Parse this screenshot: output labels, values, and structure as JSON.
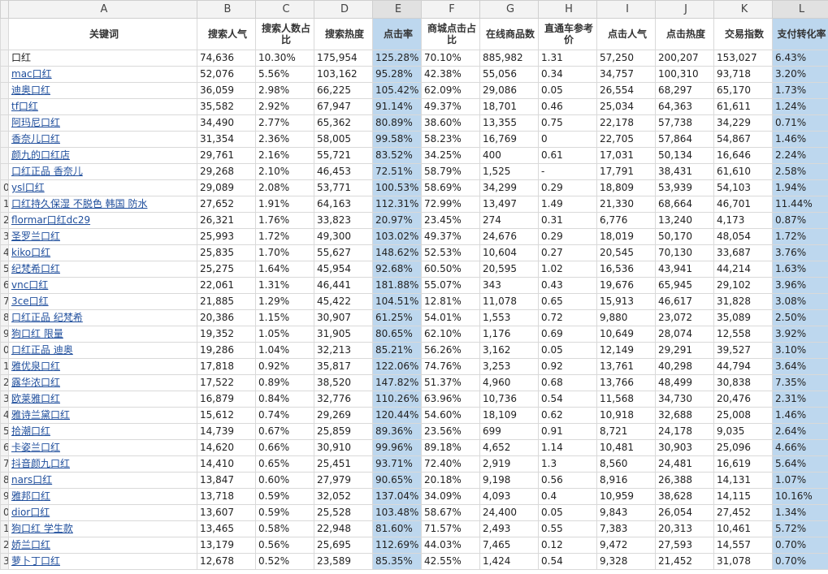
{
  "columns": [
    "A",
    "B",
    "C",
    "D",
    "E",
    "F",
    "G",
    "H",
    "I",
    "J",
    "K",
    "L"
  ],
  "headers": [
    "关键词",
    "搜索人气",
    "搜索人数占比",
    "搜索热度",
    "点击率",
    "商城点击占比",
    "在线商品数",
    "直通车参考价",
    "点击人气",
    "点击热度",
    "交易指数",
    "支付转化率"
  ],
  "rows": [
    {
      "n": "",
      "c": [
        "口红",
        "74,636",
        "10.30%",
        "175,954",
        "125.28%",
        "70.10%",
        "885,982",
        "1.31",
        "57,250",
        "200,207",
        "153,027",
        "6.43%"
      ]
    },
    {
      "n": "",
      "c": [
        "mac口红",
        "52,076",
        "5.56%",
        "103,162",
        "95.28%",
        "42.38%",
        "55,056",
        "0.34",
        "34,757",
        "100,310",
        "93,718",
        "3.20%"
      ]
    },
    {
      "n": "",
      "c": [
        "迪奥口红",
        "36,059",
        "2.98%",
        "66,225",
        "105.42%",
        "62.09%",
        "29,086",
        "0.05",
        "26,554",
        "68,297",
        "65,170",
        "1.73%"
      ]
    },
    {
      "n": "",
      "c": [
        "tf口红",
        "35,582",
        "2.92%",
        "67,947",
        "91.14%",
        "49.37%",
        "18,701",
        "0.46",
        "25,034",
        "64,363",
        "61,611",
        "1.24%"
      ]
    },
    {
      "n": "",
      "c": [
        "阿玛尼口红",
        "34,490",
        "2.77%",
        "65,362",
        "80.89%",
        "38.60%",
        "13,355",
        "0.75",
        "22,178",
        "57,738",
        "34,229",
        "0.71%"
      ]
    },
    {
      "n": "",
      "c": [
        "香奈儿口红",
        "31,354",
        "2.36%",
        "58,005",
        "99.58%",
        "58.23%",
        "16,769",
        "0",
        "22,705",
        "57,864",
        "54,867",
        "1.46%"
      ]
    },
    {
      "n": "",
      "c": [
        "颜九的口红店",
        "29,761",
        "2.16%",
        "55,721",
        "83.52%",
        "34.25%",
        "400",
        "0.61",
        "17,031",
        "50,134",
        "16,646",
        "2.24%"
      ]
    },
    {
      "n": "",
      "c": [
        "口红正品 香奈儿",
        "29,268",
        "2.10%",
        "46,453",
        "72.51%",
        "58.79%",
        "1,525",
        "-",
        "17,791",
        "38,431",
        "61,610",
        "2.58%"
      ]
    },
    {
      "n": "0",
      "c": [
        "ysl口红",
        "29,089",
        "2.08%",
        "53,771",
        "100.53%",
        "58.69%",
        "34,299",
        "0.29",
        "18,809",
        "53,939",
        "54,103",
        "1.94%"
      ]
    },
    {
      "n": "1",
      "c": [
        "口红持久保湿 不脱色 韩国 防水",
        "27,652",
        "1.91%",
        "64,163",
        "112.31%",
        "72.99%",
        "13,497",
        "1.49",
        "21,330",
        "68,664",
        "46,701",
        "11.44%"
      ]
    },
    {
      "n": "2",
      "c": [
        "flormar口红dc29",
        "26,321",
        "1.76%",
        "33,823",
        "20.97%",
        "23.45%",
        "274",
        "0.31",
        "6,776",
        "13,240",
        "4,173",
        "0.87%"
      ]
    },
    {
      "n": "3",
      "c": [
        "圣罗兰口红",
        "25,993",
        "1.72%",
        "49,300",
        "103.02%",
        "49.37%",
        "24,676",
        "0.29",
        "18,019",
        "50,170",
        "48,054",
        "1.72%"
      ]
    },
    {
      "n": "4",
      "c": [
        "kiko口红",
        "25,835",
        "1.70%",
        "55,627",
        "148.62%",
        "52.53%",
        "10,604",
        "0.27",
        "20,545",
        "70,130",
        "33,687",
        "3.76%"
      ]
    },
    {
      "n": "5",
      "c": [
        "纪梵希口红",
        "25,275",
        "1.64%",
        "45,954",
        "92.68%",
        "60.50%",
        "20,595",
        "1.02",
        "16,536",
        "43,941",
        "44,214",
        "1.63%"
      ]
    },
    {
      "n": "6",
      "c": [
        "vnc口红",
        "22,061",
        "1.31%",
        "46,441",
        "181.88%",
        "55.07%",
        "343",
        "0.43",
        "19,676",
        "65,945",
        "29,102",
        "3.96%"
      ]
    },
    {
      "n": "7",
      "c": [
        "3ce口红",
        "21,885",
        "1.29%",
        "45,422",
        "104.51%",
        "12.81%",
        "11,078",
        "0.65",
        "15,913",
        "46,617",
        "31,828",
        "3.08%"
      ]
    },
    {
      "n": "8",
      "c": [
        "口红正品 纪梵希",
        "20,386",
        "1.15%",
        "30,907",
        "61.25%",
        "54.01%",
        "1,553",
        "0.72",
        "9,880",
        "23,072",
        "35,089",
        "2.50%"
      ]
    },
    {
      "n": "9",
      "c": [
        "狗口红 限量",
        "19,352",
        "1.05%",
        "31,905",
        "80.65%",
        "62.10%",
        "1,176",
        "0.69",
        "10,649",
        "28,074",
        "12,558",
        "3.92%"
      ]
    },
    {
      "n": "0",
      "c": [
        "口红正品 迪奥",
        "19,286",
        "1.04%",
        "32,213",
        "85.21%",
        "56.26%",
        "3,162",
        "0.05",
        "12,149",
        "29,291",
        "39,527",
        "3.10%"
      ]
    },
    {
      "n": "1",
      "c": [
        "雅优泉口红",
        "17,818",
        "0.92%",
        "35,817",
        "122.06%",
        "74.76%",
        "3,253",
        "0.92",
        "13,761",
        "40,298",
        "44,794",
        "3.64%"
      ]
    },
    {
      "n": "2",
      "c": [
        "露华浓口红",
        "17,522",
        "0.89%",
        "38,520",
        "147.82%",
        "51.37%",
        "4,960",
        "0.68",
        "13,766",
        "48,499",
        "30,838",
        "7.35%"
      ]
    },
    {
      "n": "3",
      "c": [
        "欧莱雅口红",
        "16,879",
        "0.84%",
        "32,776",
        "110.26%",
        "63.96%",
        "10,736",
        "0.54",
        "11,568",
        "34,730",
        "20,476",
        "2.31%"
      ]
    },
    {
      "n": "4",
      "c": [
        "雅诗兰黛口红",
        "15,612",
        "0.74%",
        "29,269",
        "120.44%",
        "54.60%",
        "18,109",
        "0.62",
        "10,918",
        "32,688",
        "25,008",
        "1.46%"
      ]
    },
    {
      "n": "5",
      "c": [
        "拾潮口红",
        "14,739",
        "0.67%",
        "25,859",
        "89.36%",
        "23.56%",
        "699",
        "0.91",
        "8,721",
        "24,178",
        "9,035",
        "2.64%"
      ]
    },
    {
      "n": "6",
      "c": [
        "卡姿兰口红",
        "14,620",
        "0.66%",
        "30,910",
        "99.96%",
        "89.18%",
        "4,652",
        "1.14",
        "10,481",
        "30,903",
        "25,096",
        "4.66%"
      ]
    },
    {
      "n": "7",
      "c": [
        "抖音颜九口红",
        "14,410",
        "0.65%",
        "25,451",
        "93.71%",
        "72.40%",
        "2,919",
        "1.3",
        "8,560",
        "24,481",
        "16,619",
        "5.64%"
      ]
    },
    {
      "n": "8",
      "c": [
        "nars口红",
        "13,847",
        "0.60%",
        "27,979",
        "90.65%",
        "20.18%",
        "9,198",
        "0.56",
        "8,916",
        "26,388",
        "14,131",
        "1.07%"
      ]
    },
    {
      "n": "9",
      "c": [
        "雅邦口红",
        "13,718",
        "0.59%",
        "32,052",
        "137.04%",
        "34.09%",
        "4,093",
        "0.4",
        "10,959",
        "38,628",
        "14,115",
        "10.16%"
      ]
    },
    {
      "n": "0",
      "c": [
        "dior口红",
        "13,607",
        "0.59%",
        "25,528",
        "103.48%",
        "58.67%",
        "24,400",
        "0.05",
        "9,843",
        "26,054",
        "27,452",
        "1.34%"
      ]
    },
    {
      "n": "1",
      "c": [
        "狗口红 学生款",
        "13,465",
        "0.58%",
        "22,948",
        "81.60%",
        "71.57%",
        "2,493",
        "0.55",
        "7,383",
        "20,313",
        "10,461",
        "5.72%"
      ]
    },
    {
      "n": "2",
      "c": [
        "娇兰口红",
        "13,179",
        "0.56%",
        "25,695",
        "112.69%",
        "44.03%",
        "7,465",
        "0.12",
        "9,472",
        "27,593",
        "14,557",
        "0.70%"
      ]
    },
    {
      "n": "3",
      "c": [
        "萝卜丁口红",
        "12,678",
        "0.52%",
        "23,589",
        "85.35%",
        "42.55%",
        "1,424",
        "0.54",
        "9,328",
        "21,452",
        "31,078",
        "0.70%"
      ]
    }
  ]
}
